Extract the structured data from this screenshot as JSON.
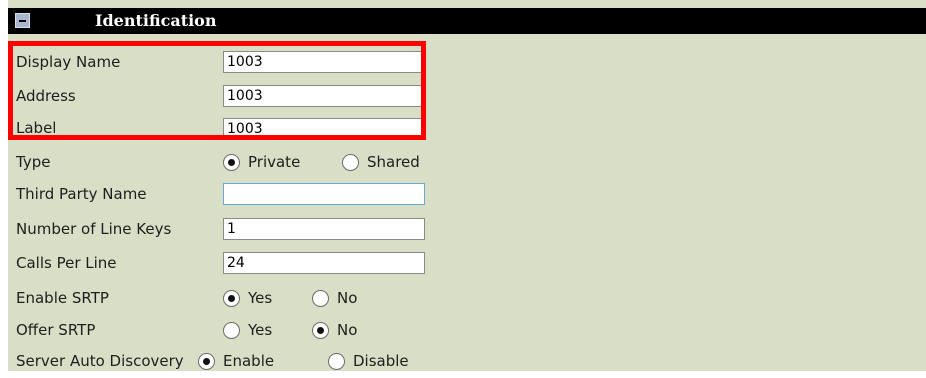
{
  "section": {
    "title": "Identification"
  },
  "fields": {
    "display_name": {
      "label": "Display Name",
      "value": "1003"
    },
    "address": {
      "label": "Address",
      "value": "1003"
    },
    "label": {
      "label": "Label",
      "value": "1003"
    },
    "type": {
      "label": "Type",
      "options": [
        "Private",
        "Shared"
      ],
      "selected": "Private"
    },
    "third_party_name": {
      "label": "Third Party Name",
      "value": ""
    },
    "num_line_keys": {
      "label": "Number of Line Keys",
      "value": "1"
    },
    "calls_per_line": {
      "label": "Calls Per Line",
      "value": "24"
    },
    "enable_srtp": {
      "label": "Enable SRTP",
      "options": [
        "Yes",
        "No"
      ],
      "selected": "Yes"
    },
    "offer_srtp": {
      "label": "Offer SRTP",
      "options": [
        "Yes",
        "No"
      ],
      "selected": "No"
    },
    "server_auto_discovery": {
      "label": "Server Auto Discovery",
      "options": [
        "Enable",
        "Disable"
      ],
      "selected": "Enable"
    }
  },
  "colors": {
    "highlight": "#ff0000",
    "panel_background": "#d9dfc6",
    "header_background": "#000000"
  },
  "icons": {
    "collapse": "collapse-minus-icon"
  }
}
